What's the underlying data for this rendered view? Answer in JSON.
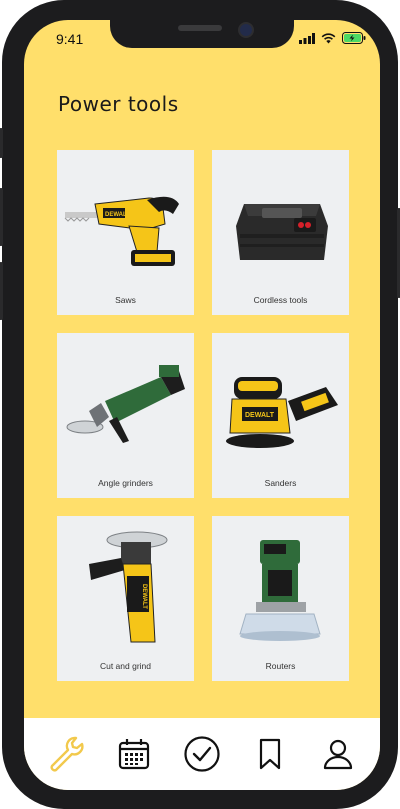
{
  "status": {
    "time": "9:41"
  },
  "page": {
    "title": "Power tools"
  },
  "categories": [
    {
      "label": "Saws",
      "icon": "reciprocating-saw-image"
    },
    {
      "label": "Cordless tools",
      "icon": "battery-pack-image"
    },
    {
      "label": "Angle grinders",
      "icon": "angle-grinder-image"
    },
    {
      "label": "Sanders",
      "icon": "orbital-sander-image"
    },
    {
      "label": "Cut and grind",
      "icon": "cut-grinder-image"
    },
    {
      "label": "Routers",
      "icon": "router-image"
    }
  ],
  "tabbar": {
    "items": [
      "wrench-icon",
      "calendar-icon",
      "check-circle-icon",
      "bookmark-icon",
      "profile-icon"
    ],
    "active": "wrench-icon",
    "active_color": "#f2c94c"
  },
  "colors": {
    "background": "#ffdf6b",
    "card": "#eef0f2",
    "dewalt_yellow": "#f5c518",
    "bosch_green": "#2f6b3a"
  }
}
